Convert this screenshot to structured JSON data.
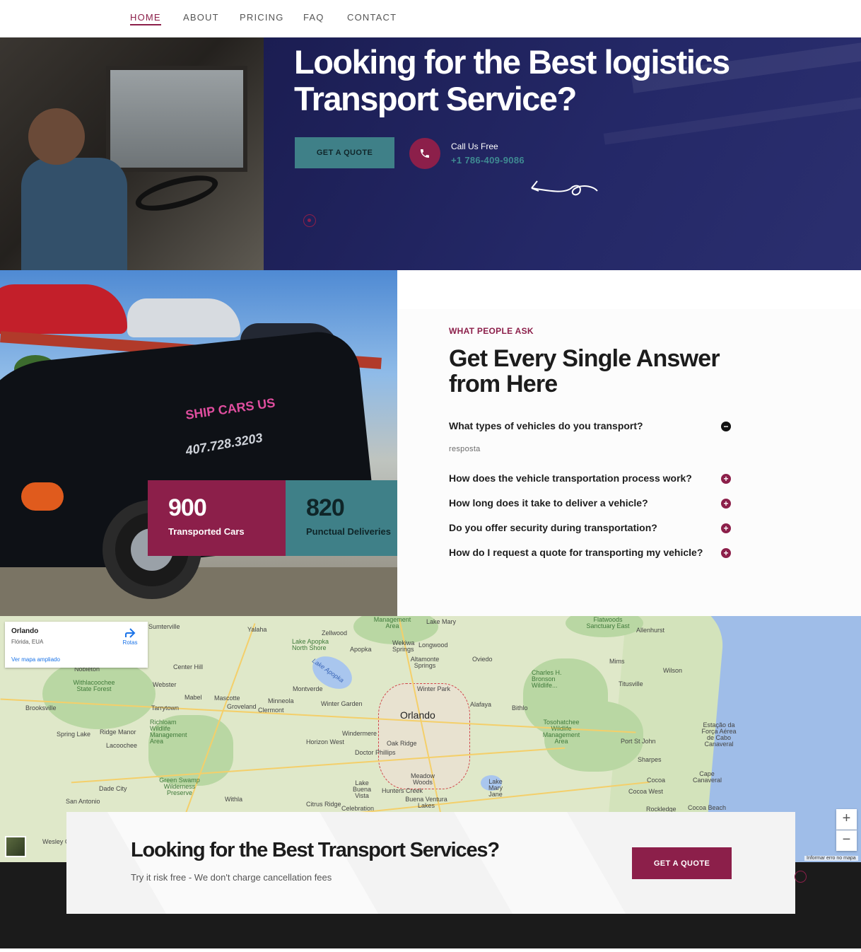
{
  "nav": {
    "items": [
      {
        "label": "HOME",
        "active": true
      },
      {
        "label": "ABOUT",
        "active": false
      },
      {
        "label": "PRICING",
        "active": false
      },
      {
        "label": "FAQ",
        "active": false
      },
      {
        "label": "CONTACT",
        "active": false
      }
    ]
  },
  "hero": {
    "title": "Looking for the Best logistics Transport Service?",
    "cta_label": "GET A QUOTE",
    "call_label": "Call Us Free",
    "call_number": "+1 786-409-9086",
    "phone_icon": "phone-icon"
  },
  "stats": [
    {
      "value": "900",
      "label": "Transported Cars"
    },
    {
      "value": "820",
      "label": "Punctual Deliveries"
    }
  ],
  "faq": {
    "kicker": "WHAT PEOPLE ASK",
    "title": "Get Every Single Answer from Here",
    "questions": [
      {
        "q": "What types of vehicles do you transport?",
        "open": true,
        "answer": "resposta"
      },
      {
        "q": "How does the vehicle transportation process work?",
        "open": false
      },
      {
        "q": "How long does it take to deliver a vehicle?",
        "open": false
      },
      {
        "q": "Do you offer security during transportation?",
        "open": false
      },
      {
        "q": "How do I request a quote for transporting my vehicle?",
        "open": false
      }
    ]
  },
  "map": {
    "card": {
      "title": "Orlando",
      "subtitle": "Flórida, EUA",
      "link": "Ver mapa ampliado",
      "directions": "Rotas"
    },
    "labels": {
      "orlando": "Orlando",
      "sumterville": "Sumterville",
      "yalaha": "Yalaha",
      "zellwood": "Zellwood",
      "lake_apopka_north_shore": "Lake Apopka North Shore",
      "apopka": "Apopka",
      "wekiwa_springs": "Wekiwa Springs",
      "longwood": "Longwood",
      "lake_mary": "Lake Mary",
      "management_area": "Management Area",
      "flatwoods_sanctuary_east": "Flatwoods Sanctuary East",
      "allenhurst": "Allenhurst",
      "mims": "Mims",
      "wilson": "Wilson",
      "titusville": "Titusville",
      "oviedo": "Oviedo",
      "altamonte_springs": "Altamonte Springs",
      "lake_apopka": "Lake Apopka",
      "center_hill": "Center Hill",
      "webster": "Webster",
      "withlacoochee": "Withlacoochee State Forest",
      "nobleton": "Nobleton",
      "brooksville": "Brooksville",
      "mabel": "Mabel",
      "mascotte": "Mascotte",
      "groveland": "Groveland",
      "minneola": "Minneola",
      "clermont": "Clermont",
      "montverde": "Montverde",
      "winter_garden": "Winter Garden",
      "winter_park": "Winter Park",
      "alafaya": "Alafaya",
      "bithlo": "Bithlo",
      "charles_bronson": "Charles H. Bronson Wildlife...",
      "tarrytown": "Tarrytown",
      "richloam": "Richloam Wildlife Management Area",
      "spring_lake": "Spring Lake",
      "ridge_manor": "Ridge Manor",
      "lacoochee": "Lacoochee",
      "horizon_west": "Horizon West",
      "windermere": "Windermere",
      "oak_ridge": "Oak Ridge",
      "doctor_phillips": "Doctor Phillips",
      "tosohatchee": "Tosohatchee Wildlife Management Area",
      "port_st_john": "Port St John",
      "estacao": "Estação da Força Aérea de Cabo Canaveral",
      "sharpes": "Sharpes",
      "cocoa": "Cocoa",
      "cape_canaveral": "Cape Canaveral",
      "cocoa_west": "Cocoa West",
      "rockledge": "Rockledge",
      "cocoa_beach": "Cocoa Beach",
      "dade_city": "Dade City",
      "san_antonio": "San Antonio",
      "green_swamp": "Green Swamp Wilderness Preserve",
      "withla": "Withla",
      "lake_buena_vista": "Lake Buena Vista",
      "hunters_creek": "Hunters Creek",
      "meadow_woods": "Meadow Woods",
      "lake_mary_jane": "Lake Mary Jane",
      "citrus_ridge": "Citrus Ridge",
      "celebration": "Celebration",
      "buena_ventura_lakes": "Buena Ventura Lakes",
      "wesley": "Wesley C",
      "report": "Informar erro no mapa"
    },
    "zoom_in": "+",
    "zoom_out": "−"
  },
  "cta": {
    "title": "Looking for the Best Transport Services?",
    "subtitle": "Try it risk free - We don't charge cancellation fees",
    "button": "GET A QUOTE"
  },
  "colors": {
    "brand_red": "#8c1f4a",
    "brand_teal": "#3f8088",
    "hero_navy": "#1a1c4e",
    "footer_dark": "#1b1b1b"
  }
}
